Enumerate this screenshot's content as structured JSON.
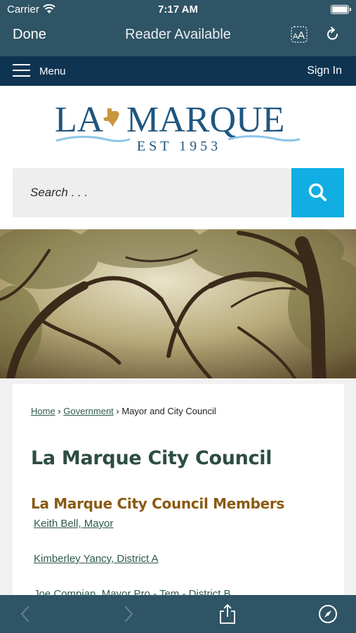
{
  "status_bar": {
    "carrier": "Carrier",
    "time": "7:17 AM"
  },
  "browser": {
    "done_label": "Done",
    "reader_label": "Reader Available",
    "aa_label": "AA"
  },
  "site_nav": {
    "menu_label": "Menu",
    "signin_label": "Sign In"
  },
  "logo": {
    "name": "LA MARQUE",
    "est": "EST 1953"
  },
  "search": {
    "placeholder": "Search . . ."
  },
  "breadcrumb": {
    "home": "Home",
    "sep1": " › ",
    "government": "Government",
    "sep2": " › ",
    "current": "Mayor and City Council"
  },
  "main": {
    "title": "La Marque City Council",
    "members_heading": "La Marque City Council Members",
    "members": [
      "Keith Bell, Mayor",
      "Kimberley Yancy, District A",
      "Joe Compian, Mayor Pro - Tem - District B"
    ]
  },
  "colors": {
    "chrome": "#2f5465",
    "site_nav": "#0f3452",
    "search_button": "#10aee3",
    "title": "#2d4d44",
    "section_title": "#8a5a12",
    "link": "#2e5a4f"
  }
}
